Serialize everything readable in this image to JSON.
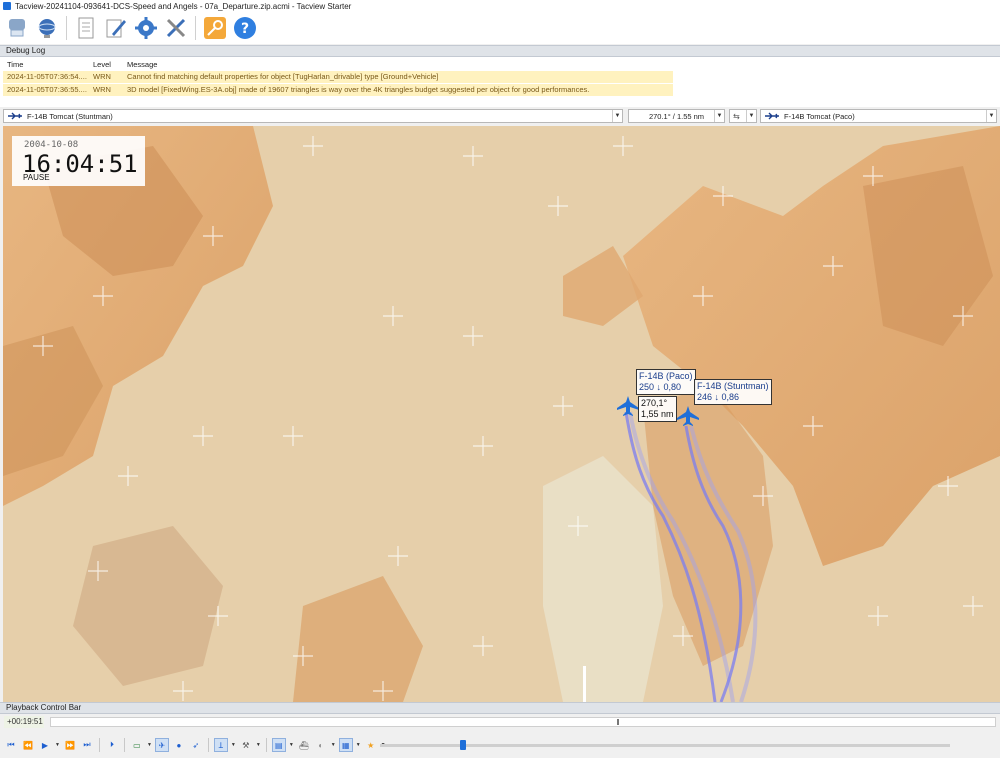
{
  "window": {
    "title": "Tacview-20241104-093641-DCS-Speed and Angels - 07a_Departure.zip.acmi - Tacview Starter"
  },
  "toolbar": {
    "buttons": [
      "open-recording-icon",
      "globe-icon",
      "document-icon",
      "pen-icon",
      "gear-icon",
      "tools-icon",
      "key-icon",
      "help-icon"
    ]
  },
  "debug_log": {
    "title": "Debug Log",
    "columns": {
      "time": "Time",
      "level": "Level",
      "message": "Message"
    },
    "rows": [
      {
        "time": "2024-11-05T07:36:54....",
        "level": "WRN",
        "message": "Cannot find matching default properties for object [TugHarlan_drivable] type [Ground+Vehicle]"
      },
      {
        "time": "2024-11-05T07:36:55....",
        "level": "WRN",
        "message": "3D model [FixedWing.ES-3A.obj] made of 19607 triangles is way over the 4K triangles budget suggested per object for good performances."
      }
    ]
  },
  "selectors": {
    "primary_object": "F-14B Tomcat (Stuntman)",
    "bearing_range": "270.1° / 1.55 nm",
    "secondary_object": "F-14B Tomcat (Paco)"
  },
  "hud": {
    "date": "2004-10-08",
    "time": "16:04:51",
    "state": "PAUSE"
  },
  "labels": {
    "paco": {
      "name": "F-14B (Paco)",
      "data": "250 ↓ 0,80"
    },
    "stuntman": {
      "name": "F-14B (Stuntman)",
      "data": "246 ↓ 0,86"
    },
    "bra": {
      "bearing": "270,1°",
      "range": "1,55 nm"
    }
  },
  "playback": {
    "title": "Playback Control Bar",
    "elapsed": "+00:19:51",
    "position_fraction": 0.6,
    "speed_fraction": 0.14
  },
  "colors": {
    "aircraft": "#1e6fd9",
    "trail": "#7b7ef0",
    "terrain_light": "#e6cfaa",
    "terrain_ridge": "#e0a870"
  }
}
